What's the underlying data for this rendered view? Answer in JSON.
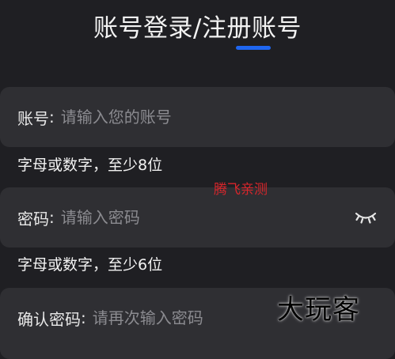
{
  "header": {
    "title": "账号登录/注册账号"
  },
  "form": {
    "account": {
      "label": "账号",
      "colon": ":",
      "placeholder": "请输入您的账号",
      "value": "",
      "hint": "字母或数字，至少8位"
    },
    "password": {
      "label": "密码",
      "colon": ":",
      "placeholder": "请输入密码",
      "value": "",
      "hint": "字母或数字，至少6位",
      "toggle_icon": "eye-closed-icon"
    },
    "confirm_password": {
      "label": "确认密码",
      "colon": ":",
      "placeholder": "请再次输入密码",
      "value": ""
    }
  },
  "watermarks": {
    "tengfei": "腾飞亲测",
    "dawanke": "大玩客"
  },
  "colors": {
    "background": "#1f1f23",
    "field_background": "#2f2f33",
    "accent": "#1f66f0",
    "placeholder": "#8b8b90",
    "watermark_red": "#d8262b"
  }
}
